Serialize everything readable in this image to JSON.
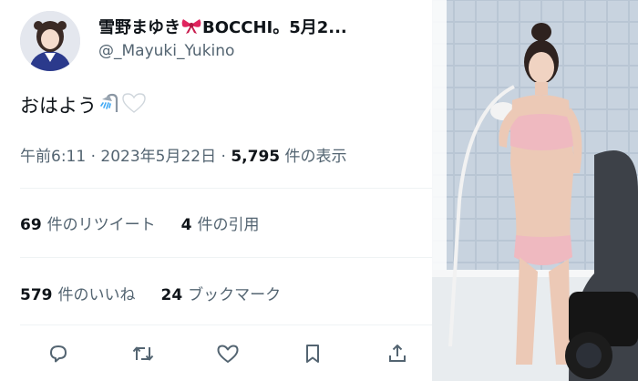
{
  "user": {
    "display_name": "雪野まゆき",
    "display_name_suffix": "BOCCHI。5月2...",
    "handle": "@_Mayuki_Yukino",
    "name_emoji": "ribbon-icon"
  },
  "tweet": {
    "text": "おはよう",
    "emojis": [
      "shower-icon",
      "white-heart-icon"
    ],
    "time": "午前6:11",
    "separator": "·",
    "date": "2023年5月22日",
    "views_count": "5,795",
    "views_label": "件の表示"
  },
  "stats": {
    "retweets": {
      "count": "69",
      "label": "件のリツイート"
    },
    "quotes": {
      "count": "4",
      "label": "件の引用"
    },
    "likes": {
      "count": "579",
      "label": "件のいいね"
    },
    "bookmarks": {
      "count": "24",
      "label": "ブックマーク"
    }
  },
  "actions": [
    "reply-icon",
    "retweet-icon",
    "like-icon",
    "bookmark-icon",
    "share-icon"
  ],
  "colors": {
    "text_primary": "#0f1419",
    "text_secondary": "#536471",
    "divider": "#eff3f4",
    "icon": "#536471",
    "ribbon": "#e0245e"
  }
}
